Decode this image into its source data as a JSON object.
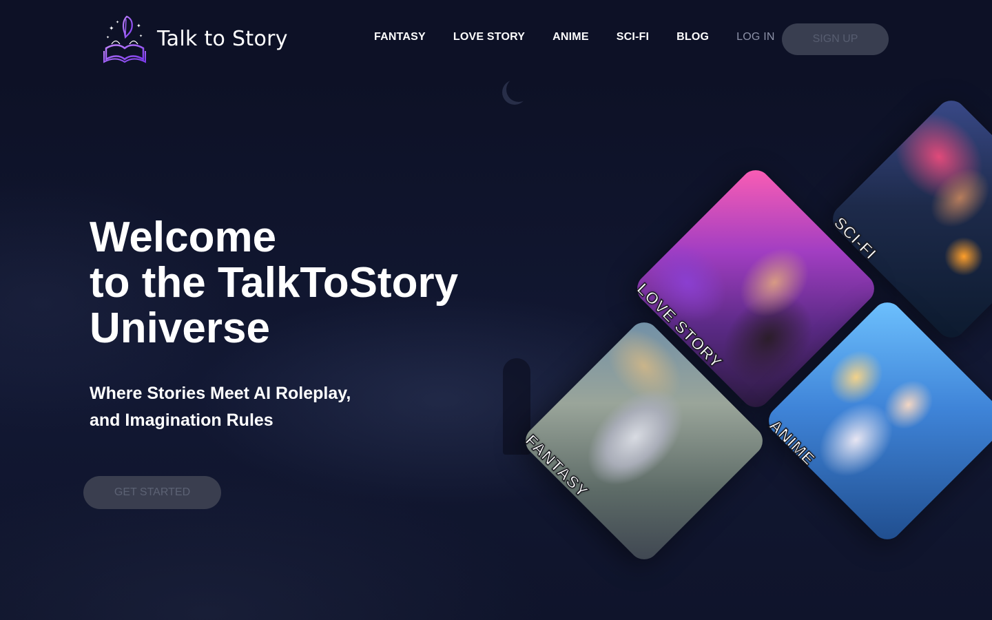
{
  "brand": {
    "name": "Talk to Story",
    "accent": "#8b5cf6"
  },
  "nav": {
    "items": [
      {
        "label": "FANTASY"
      },
      {
        "label": "LOVE STORY"
      },
      {
        "label": "ANIME"
      },
      {
        "label": "SCI-FI"
      },
      {
        "label": "BLOG"
      }
    ],
    "login": "LOG IN",
    "signup": "SIGN UP"
  },
  "hero": {
    "title_lines": [
      "Welcome",
      "to the TalkToStory",
      "Universe"
    ],
    "subtitle_lines": [
      "Where Stories Meet AI Roleplay,",
      "and Imagination Rules"
    ],
    "cta": "GET STARTED"
  },
  "cards": {
    "fantasy": "FANTASY",
    "love_story": "LOVE STORY",
    "sci_fi": "SCI-FI",
    "anime": "ANIME"
  },
  "colors": {
    "background": "#0d1126",
    "button_disabled": "#393e50",
    "button_text_disabled": "#575d70"
  }
}
